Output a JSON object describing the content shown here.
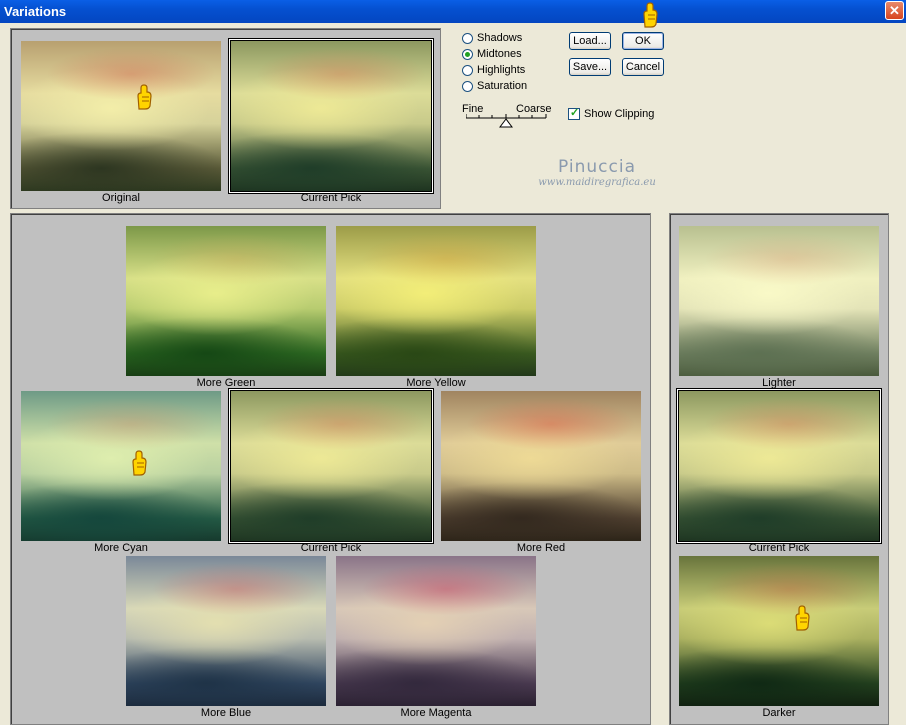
{
  "window": {
    "title": "Variations",
    "close_glyph": "✕"
  },
  "top": {
    "original_caption": "Original",
    "current_caption": "Current Pick"
  },
  "options": {
    "modes": [
      {
        "label": "Shadows",
        "selected": false
      },
      {
        "label": "Midtones",
        "selected": true
      },
      {
        "label": "Highlights",
        "selected": false
      },
      {
        "label": "Saturation",
        "selected": false
      }
    ],
    "slider": {
      "fine_label": "Fine",
      "coarse_label": "Coarse"
    },
    "show_clipping": {
      "label": "Show Clipping",
      "checked": true
    }
  },
  "buttons": {
    "load": "Load...",
    "ok": "OK",
    "save": "Save...",
    "cancel": "Cancel"
  },
  "watermark": {
    "name": "Pinuccia",
    "url": "www.maidiregrafica.eu"
  },
  "color_grid": {
    "more_green": "More Green",
    "more_yellow": "More Yellow",
    "more_cyan": "More Cyan",
    "current": "Current Pick",
    "more_red": "More Red",
    "more_blue": "More Blue",
    "more_magenta": "More Magenta"
  },
  "brightness": {
    "lighter": "Lighter",
    "current": "Current Pick",
    "darker": "Darker"
  },
  "icons": [
    "pointing-hand-icon",
    "close-icon",
    "slider-triangle-icon",
    "checkmark-icon"
  ]
}
